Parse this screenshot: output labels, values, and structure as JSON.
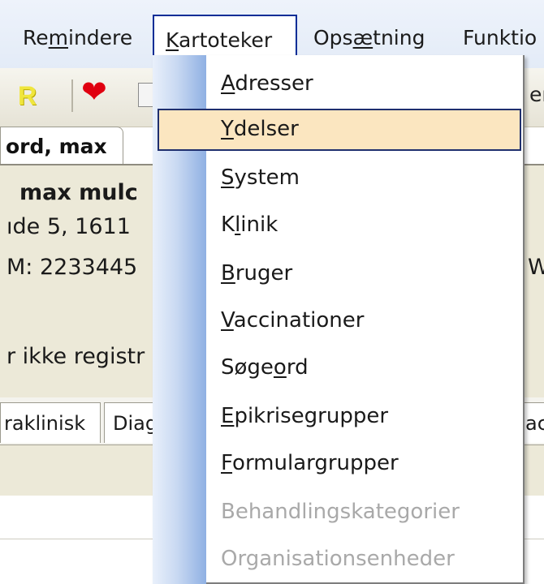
{
  "menubar": {
    "items": [
      {
        "pre": "Re",
        "u": "m",
        "post": "indere"
      },
      {
        "pre": "",
        "u": "K",
        "post": "artoteker"
      },
      {
        "pre": "Ops",
        "u": "æ",
        "post": "tning"
      },
      {
        "pre": "Funktio",
        "u": "",
        "post": ""
      }
    ]
  },
  "toolbar": {
    "r_label": "R",
    "heart_icon": "heart-icon",
    "right_text": "er"
  },
  "patient_tab": {
    "label": "ord, max"
  },
  "patient": {
    "name": "max mulc",
    "address": "ıde 5, 1611",
    "phone": "M: 2233445",
    "right_fragment": "W",
    "status": "r ikke registr"
  },
  "bottom_tabs": [
    "raklinisk",
    "Diag",
    "ac"
  ],
  "dropdown": {
    "items": [
      {
        "pre": "",
        "u": "A",
        "post": "dresser",
        "state": "normal"
      },
      {
        "pre": "",
        "u": "Y",
        "post": "delser",
        "state": "highlighted"
      },
      {
        "pre": "",
        "u": "S",
        "post": "ystem",
        "state": "normal"
      },
      {
        "pre": "K",
        "u": "l",
        "post": "inik",
        "state": "normal"
      },
      {
        "pre": "",
        "u": "B",
        "post": "ruger",
        "state": "normal"
      },
      {
        "pre": "",
        "u": "V",
        "post": "accinationer",
        "state": "normal"
      },
      {
        "pre": "Søge",
        "u": "o",
        "post": "rd",
        "state": "normal"
      },
      {
        "pre": "",
        "u": "E",
        "post": "pikrisegrupper",
        "state": "normal"
      },
      {
        "pre": "",
        "u": "F",
        "post": "ormulargrupper",
        "state": "normal"
      },
      {
        "pre": "Behandlingskategorier",
        "u": "",
        "post": "",
        "state": "disabled"
      },
      {
        "pre": "Organisationsenheder",
        "u": "",
        "post": "",
        "state": "disabled"
      }
    ]
  }
}
